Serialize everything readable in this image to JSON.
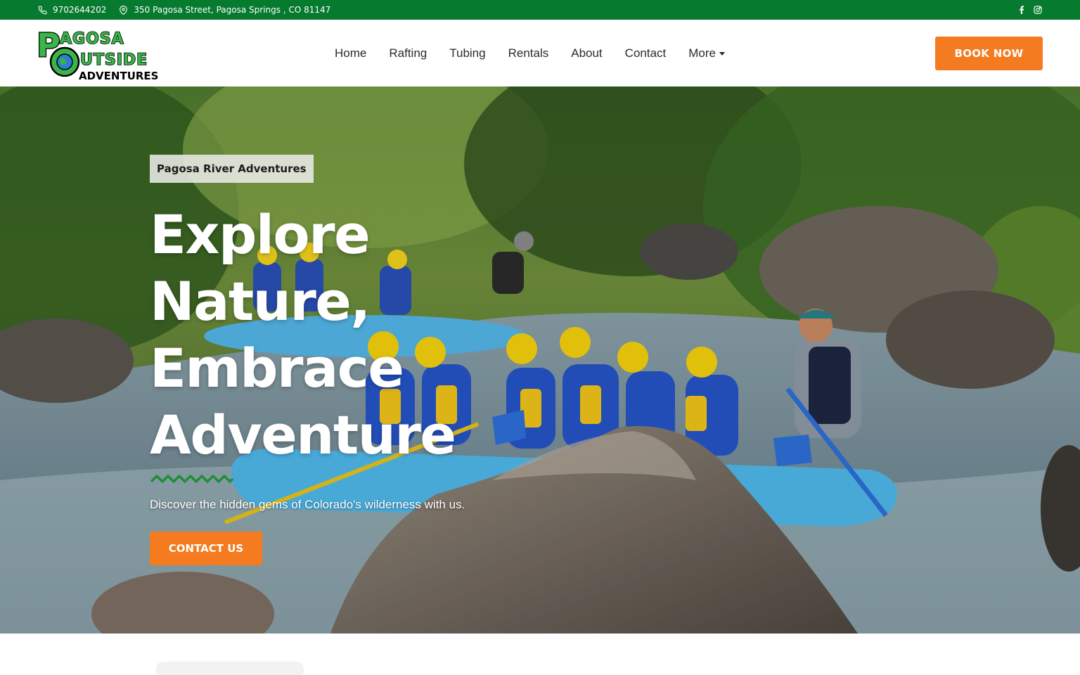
{
  "topbar": {
    "phone": "9702644202",
    "address": "350 Pagosa Street, Pagosa Springs , CO 81147",
    "background": "#067a2e"
  },
  "logo": {
    "line1": "AGOSA",
    "line2": "UTSIDE",
    "line3": "ADVENTURES"
  },
  "nav": {
    "items": [
      {
        "label": "Home"
      },
      {
        "label": "Rafting"
      },
      {
        "label": "Tubing"
      },
      {
        "label": "Rentals"
      },
      {
        "label": "About"
      },
      {
        "label": "Contact"
      },
      {
        "label": "More"
      }
    ],
    "book_label": "BOOK NOW"
  },
  "hero": {
    "badge": "Pagosa River Adventures",
    "headline": [
      "Explore",
      "Nature,",
      "Embrace",
      "Adventure"
    ],
    "subtext": "Discover the hidden gems of Colorado's wilderness with us.",
    "cta_label": "CONTACT US"
  },
  "colors": {
    "accent": "#f47b20",
    "brand_green": "#067a2e"
  },
  "icons": [
    "phone-icon",
    "map-pin-icon",
    "facebook-icon",
    "instagram-icon",
    "chevron-down-icon"
  ]
}
